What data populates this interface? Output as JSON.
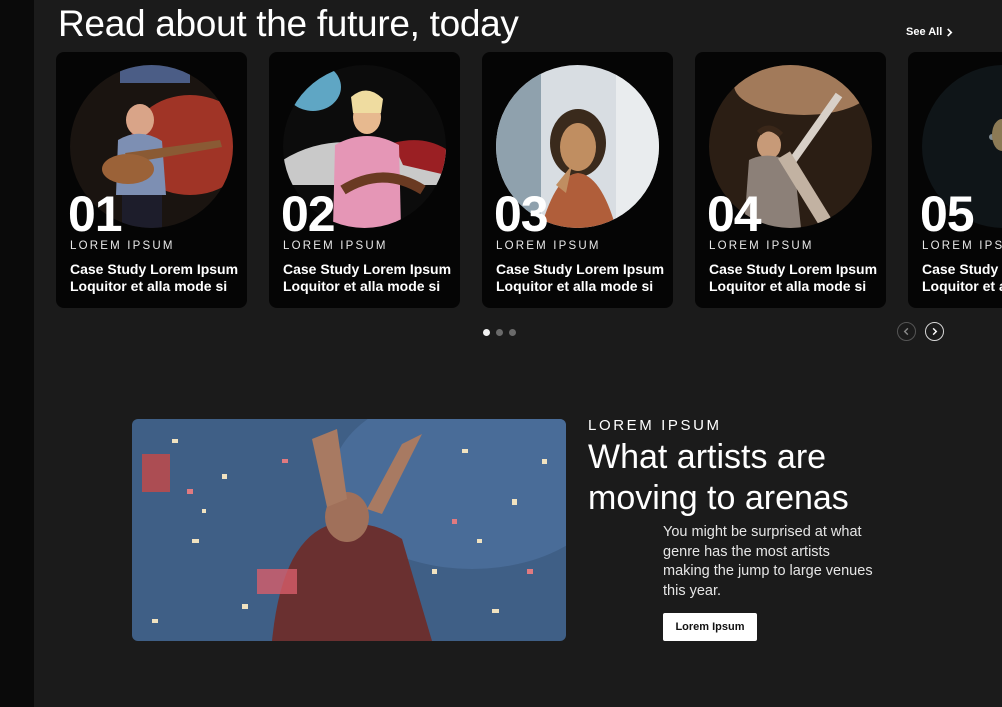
{
  "section": {
    "title": "Read about the future, today",
    "see_all": "See All"
  },
  "cards": [
    {
      "number": "01",
      "eyebrow": "LOREM IPSUM",
      "title_line1": "Case Study Lorem Ipsum",
      "title_line2": "Loquitor et alla mode si"
    },
    {
      "number": "02",
      "eyebrow": "LOREM IPSUM",
      "title_line1": "Case Study Lorem Ipsum",
      "title_line2": "Loquitor et alla mode si"
    },
    {
      "number": "03",
      "eyebrow": "LOREM IPSUM",
      "title_line1": "Case Study Lorem Ipsum",
      "title_line2": "Loquitor et alla mode si"
    },
    {
      "number": "04",
      "eyebrow": "LOREM IPSUM",
      "title_line1": "Case Study Lorem Ipsum",
      "title_line2": "Loquitor et alla mode si"
    },
    {
      "number": "05",
      "eyebrow": "LOREM IPSUM",
      "title_line1": "Case Study Lorem Ipsum",
      "title_line2": "Loquitor et alla mode si"
    }
  ],
  "pagination": {
    "dots": 3,
    "active_index": 0
  },
  "feature": {
    "eyebrow": "LOREM IPSUM",
    "title_line1": "What artists are",
    "title_line2": "moving to arenas",
    "body": "You might be surprised at what genre has the most artists making the jump to large venues this year.",
    "button_label": "Lorem Ipsum"
  },
  "colors": {
    "background": "#1b1b1b",
    "card": "#050505",
    "accent": "#ffffff"
  },
  "icons": {
    "see_all": "chevron-right-icon",
    "prev": "chevron-left-icon",
    "next": "chevron-right-icon"
  }
}
